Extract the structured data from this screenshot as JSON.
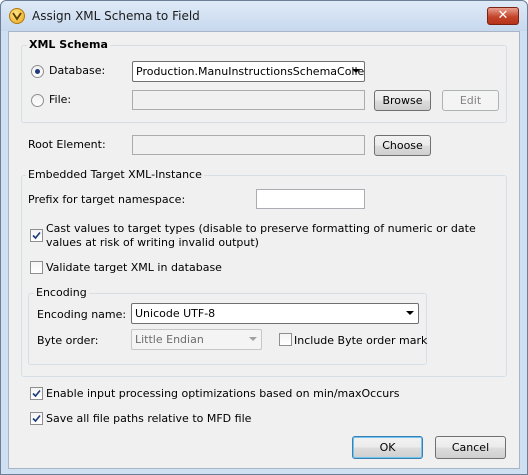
{
  "window": {
    "title": "Assign XML Schema to Field",
    "close_glyph": "✕",
    "icon": "altova-logo-icon"
  },
  "xml_schema": {
    "group_label": "XML Schema",
    "database_label": "Database:",
    "database_value": "Production.ManuInstructionsSchemaCollecti",
    "database_selected": true,
    "file_label": "File:",
    "file_value": "",
    "browse_label": "Browse",
    "edit_label": "Edit"
  },
  "root_element": {
    "label": "Root Element:",
    "value": "",
    "choose_label": "Choose"
  },
  "embedded": {
    "group_label": "Embedded Target XML-Instance",
    "prefix_label": "Prefix for target namespace:",
    "prefix_value": "",
    "cast_line1": "Cast values to target types (disable to preserve formatting of numeric or date",
    "cast_line2": "values at risk of writing invalid output)",
    "cast_checked": true,
    "validate_label": "Validate target XML in database",
    "validate_checked": false,
    "encoding": {
      "group_label": "Encoding",
      "name_label": "Encoding name:",
      "name_value": "Unicode UTF-8",
      "byte_order_label": "Byte order:",
      "byte_order_value": "Little Endian",
      "bom_label": "Include Byte order mark",
      "bom_checked": false
    }
  },
  "options": {
    "enable_label": "Enable input processing optimizations based on min/maxOccurs",
    "enable_checked": true,
    "save_label": "Save all file paths relative to MFD file",
    "save_checked": true
  },
  "buttons": {
    "ok": "OK",
    "cancel": "Cancel"
  }
}
